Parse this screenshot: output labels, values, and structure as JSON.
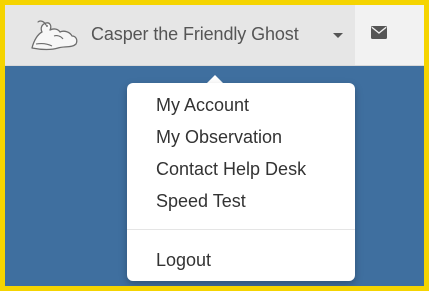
{
  "user_menu": {
    "name": "Casper the Friendly Ghost",
    "avatar_icon": "ghost-icon",
    "caret_icon": "caret-down-icon"
  },
  "mail": {
    "icon": "envelope-icon"
  },
  "dropdown": {
    "items": [
      {
        "label": "My Account"
      },
      {
        "label": "My Observation"
      },
      {
        "label": "Contact Help Desk"
      },
      {
        "label": "Speed Test"
      }
    ],
    "logout_label": "Logout"
  },
  "colors": {
    "border": "#f5d400",
    "background": "#3f6f9f",
    "topbar": "#f2f2f2",
    "toggle_active": "#e6e6e6",
    "text": "#333333"
  }
}
